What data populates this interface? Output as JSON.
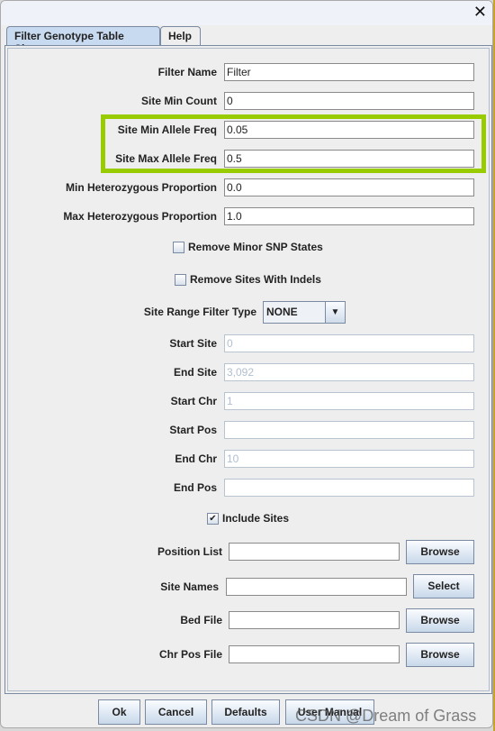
{
  "window": {
    "close_icon": "close-icon"
  },
  "tabs": [
    {
      "label": "Filter Genotype Table Sites",
      "active": true
    },
    {
      "label": "Help",
      "active": false
    }
  ],
  "fields": [
    {
      "label": "Filter Name",
      "value": "Filter"
    },
    {
      "label": "Site Min Count",
      "value": "0"
    },
    {
      "label": "Site Min Allele Freq",
      "value": "0.05"
    },
    {
      "label": "Site Max Allele Freq",
      "value": "0.5"
    },
    {
      "label": "Min Heterozygous Proportion",
      "value": "0.0"
    },
    {
      "label": "Max Heterozygous Proportion",
      "value": "1.0"
    }
  ],
  "highlight_color": "#99cc00",
  "checkboxes": [
    {
      "label": "Remove Minor SNP States",
      "checked": false
    },
    {
      "label": "Remove Sites With Indels",
      "checked": false
    }
  ],
  "site_range": {
    "label": "Site Range Filter Type",
    "value": "NONE"
  },
  "range_fields": [
    {
      "label": "Start Site",
      "value": "0"
    },
    {
      "label": "End Site",
      "value": "3,092"
    },
    {
      "label": "Start Chr",
      "value": "1"
    },
    {
      "label": "Start Pos",
      "value": ""
    },
    {
      "label": "End Chr",
      "value": "10"
    },
    {
      "label": "End Pos",
      "value": ""
    }
  ],
  "include_sites": {
    "label": "Include Sites",
    "checked": true,
    "mark": "✔"
  },
  "file_rows": [
    {
      "label": "Position List",
      "value": "",
      "button": "Browse"
    },
    {
      "label": "Site Names",
      "value": "",
      "button": "Select"
    },
    {
      "label": "Bed File",
      "value": "",
      "button": "Browse"
    },
    {
      "label": "Chr Pos File",
      "value": "",
      "button": "Browse"
    }
  ],
  "footer": {
    "ok": "Ok",
    "cancel": "Cancel",
    "defaults": "Defaults",
    "user_manual": "User Manual"
  },
  "watermark": "CSDN @Dream of Grass"
}
